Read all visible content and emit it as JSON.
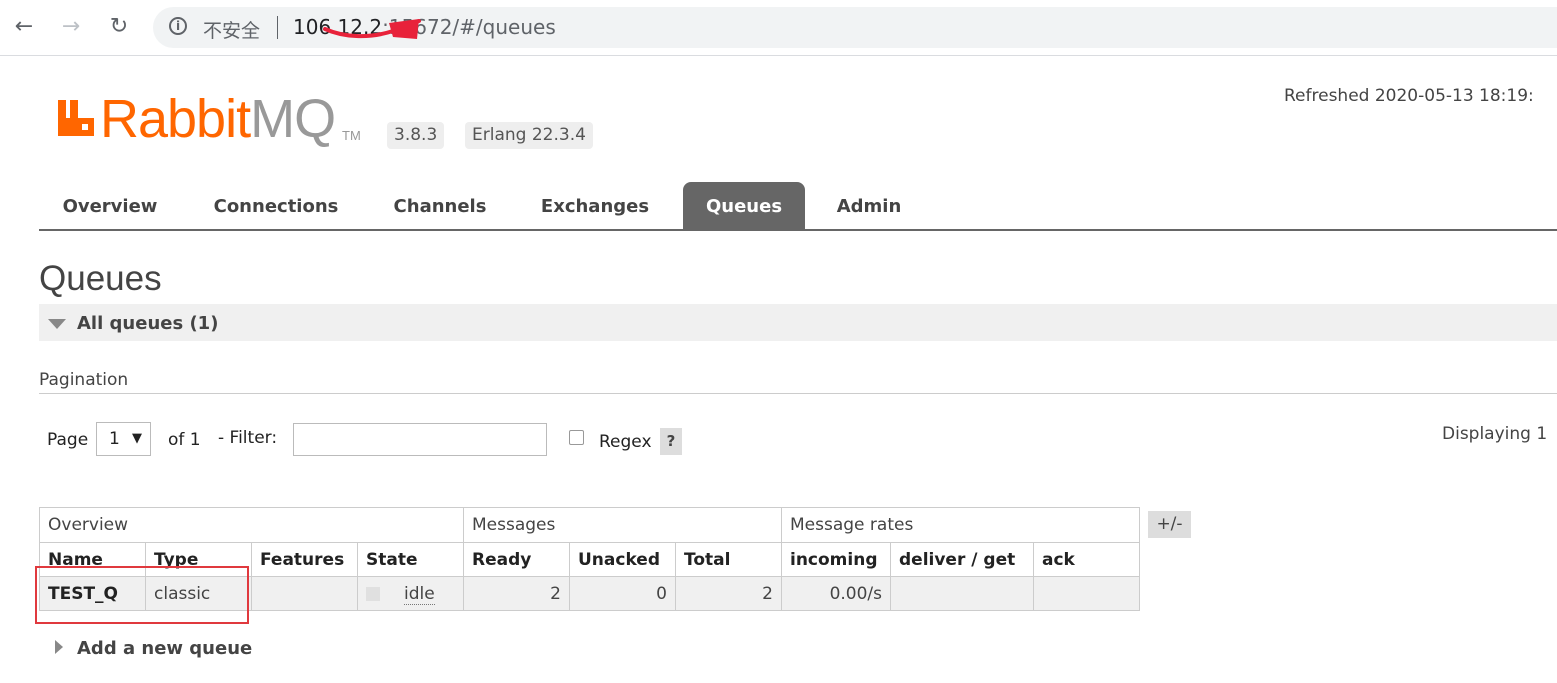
{
  "browser": {
    "security_label": "不安全",
    "url_host": "106.12.2",
    "url_rest": ":15672/#/queues",
    "back_icon": "arrow-left-icon",
    "forward_icon": "arrow-right-icon",
    "reload_icon": "reload-icon"
  },
  "header": {
    "brand_rabbit": "Rabbit",
    "brand_mq": "MQ",
    "trademark": "TM",
    "version": "3.8.3",
    "erlang": "Erlang 22.3.4",
    "refreshed": "Refreshed 2020-05-13 18:19:",
    "brand_color": "#ff6600"
  },
  "tabs": [
    {
      "label": "Overview"
    },
    {
      "label": "Connections"
    },
    {
      "label": "Channels"
    },
    {
      "label": "Exchanges"
    },
    {
      "label": "Queues",
      "active": true
    },
    {
      "label": "Admin"
    }
  ],
  "page": {
    "title": "Queues",
    "section_label": "All queues (1)"
  },
  "pagination": {
    "title": "Pagination",
    "page_label": "Page",
    "page_value": "1",
    "of_label": "of 1",
    "filter_label": "- Filter:",
    "filter_value": "",
    "regex_label": "Regex",
    "help_label": "?",
    "displaying": "Displaying 1"
  },
  "table": {
    "groups": [
      "Overview",
      "Messages",
      "Message rates"
    ],
    "columns": [
      "Name",
      "Type",
      "Features",
      "State",
      "Ready",
      "Unacked",
      "Total",
      "incoming",
      "deliver / get",
      "ack"
    ],
    "rows": [
      {
        "name": "TEST_Q",
        "type": "classic",
        "features": "",
        "state": "idle",
        "ready": "2",
        "unacked": "0",
        "total": "2",
        "incoming": "0.00/s",
        "deliver_get": "",
        "ack": ""
      }
    ],
    "toggle_label": "+/-"
  },
  "add_queue_label": "Add a new queue"
}
